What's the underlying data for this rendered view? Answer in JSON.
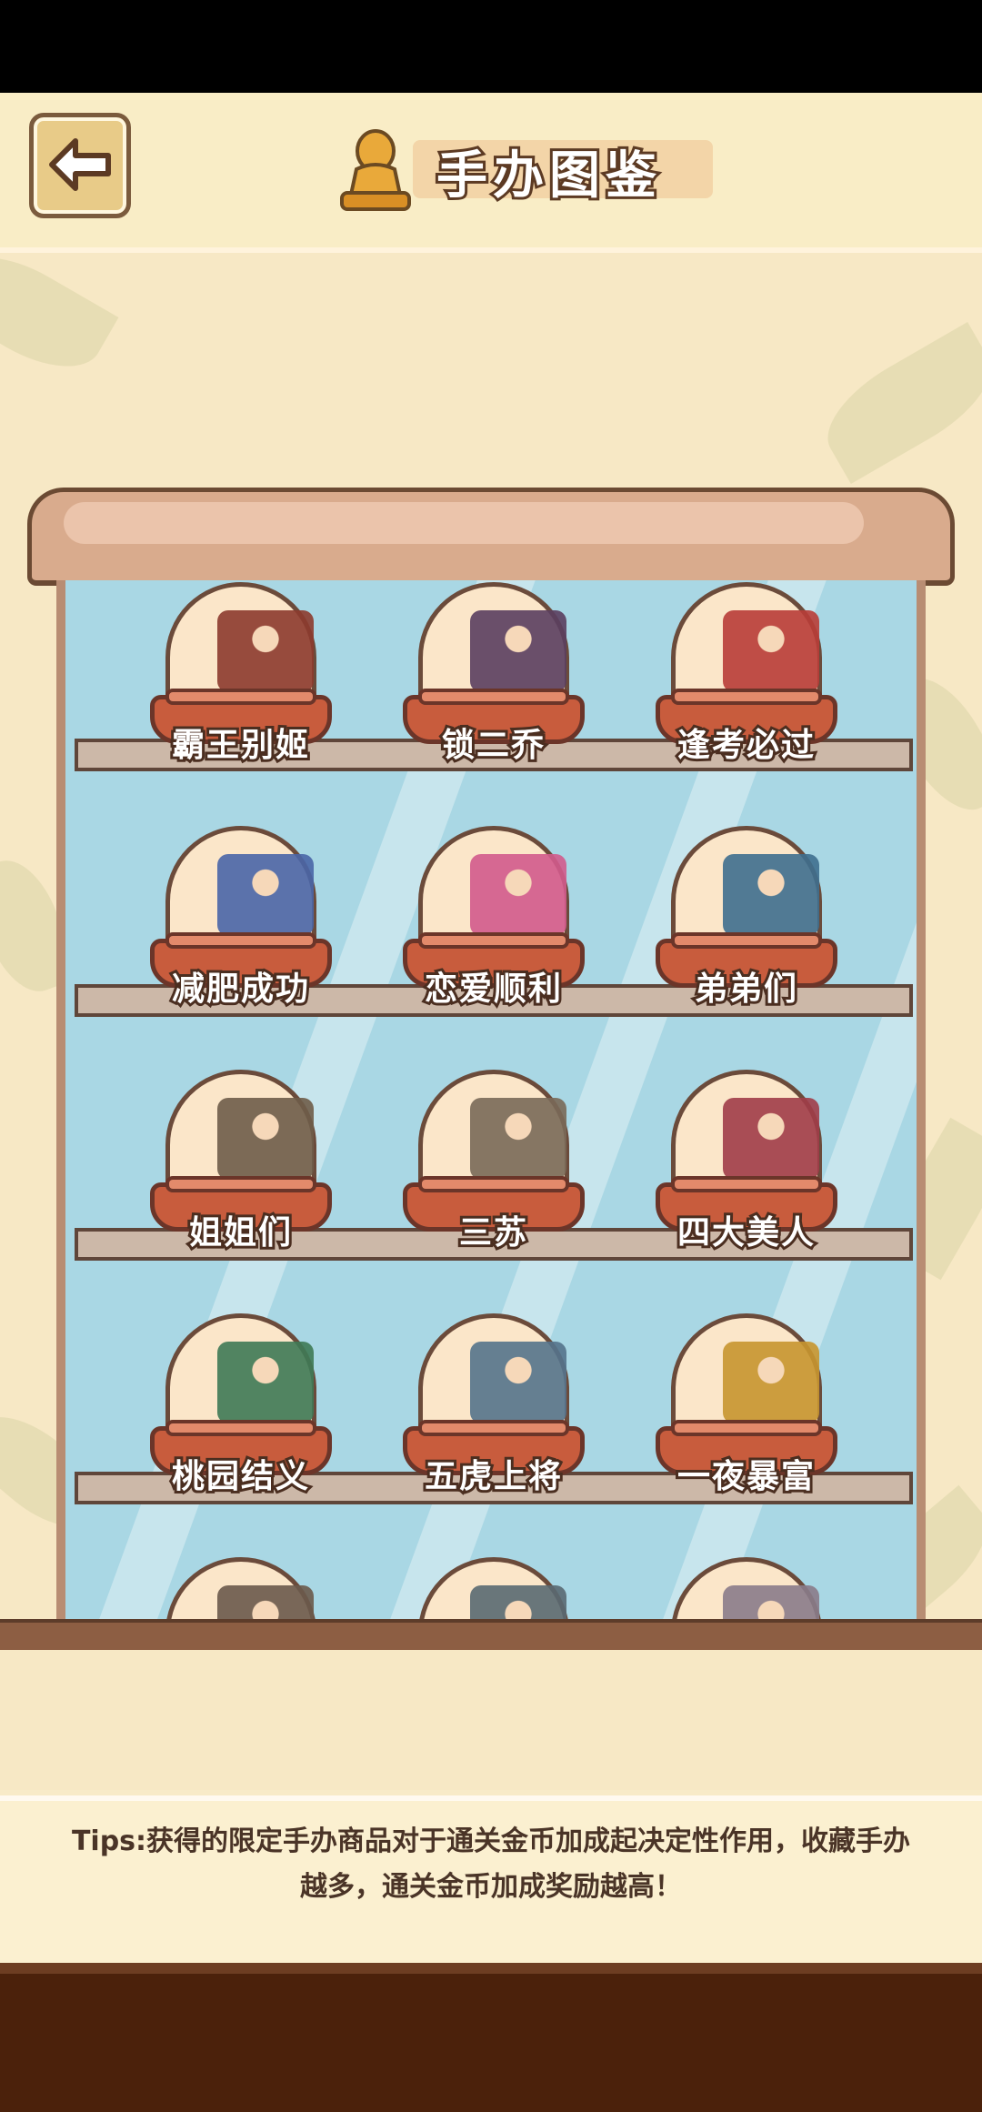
{
  "header": {
    "title": "手办图鉴",
    "back_icon": "back-arrow-icon",
    "trophy_icon": "trophy-figure-icon"
  },
  "figures": [
    {
      "label": "霸王别姬",
      "color": "#8d3b2e"
    },
    {
      "label": "锁二乔",
      "color": "#5b3f60"
    },
    {
      "label": "逢考必过",
      "color": "#b93d38"
    },
    {
      "label": "减肥成功",
      "color": "#4a66a8"
    },
    {
      "label": "恋爱顺利",
      "color": "#d35b8d"
    },
    {
      "label": "弟弟们",
      "color": "#3f6f8f"
    },
    {
      "label": "姐姐们",
      "color": "#6f5d4a"
    },
    {
      "label": "三苏",
      "color": "#7a6a58"
    },
    {
      "label": "四大美人",
      "color": "#a13d49"
    },
    {
      "label": "桃园结义",
      "color": "#3f7a56"
    },
    {
      "label": "五虎上将",
      "color": "#55748c"
    },
    {
      "label": "一夜暴富",
      "color": "#c8962f"
    },
    {
      "label": "",
      "color": "#6b5a4c"
    },
    {
      "label": "",
      "color": "#5a6a72"
    },
    {
      "label": "",
      "color": "#8a7c8a"
    }
  ],
  "tips": {
    "line1": "Tips:获得的限定手办商品对于通关金币加成起决定性作用，收藏手办",
    "line2": "越多，通关金币加成奖励越高！"
  }
}
